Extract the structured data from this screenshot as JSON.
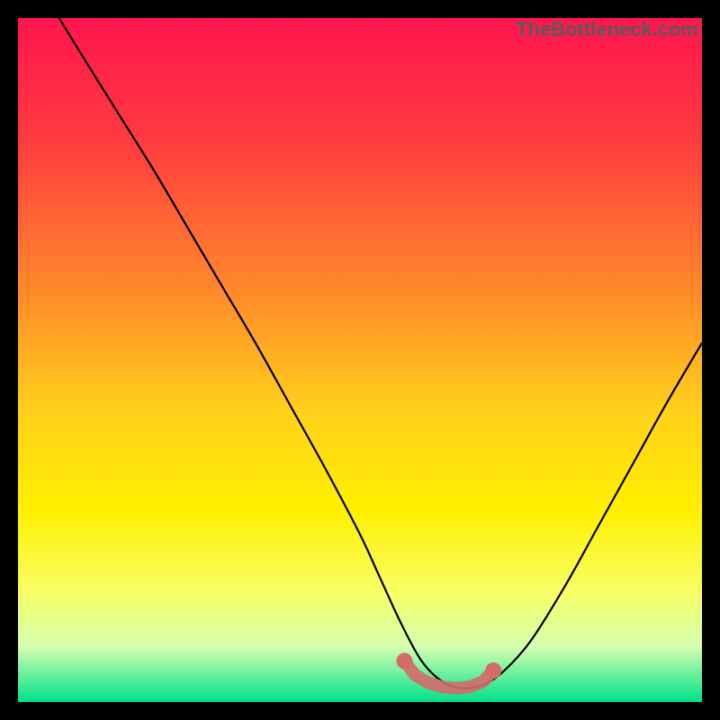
{
  "watermark": "TheBottleneck.com",
  "chart_data": {
    "type": "line",
    "title": "",
    "xlabel": "",
    "ylabel": "",
    "xlim": [
      0,
      100
    ],
    "ylim": [
      0,
      100
    ],
    "gradient_stops": [
      {
        "offset": 0,
        "color": "#ff154f"
      },
      {
        "offset": 18,
        "color": "#ff3b3f"
      },
      {
        "offset": 40,
        "color": "#ff8a2a"
      },
      {
        "offset": 58,
        "color": "#ffd21a"
      },
      {
        "offset": 72,
        "color": "#fff000"
      },
      {
        "offset": 84,
        "color": "#f7ff66"
      },
      {
        "offset": 92,
        "color": "#d4ffb0"
      },
      {
        "offset": 100,
        "color": "#00e08a"
      }
    ],
    "series": [
      {
        "name": "curve",
        "stroke": "#000000",
        "x": [
          6,
          10,
          15,
          20,
          25,
          30,
          35,
          40,
          45,
          50,
          53,
          56,
          59,
          62,
          65,
          68,
          71,
          75,
          80,
          85,
          90,
          95,
          100
        ],
        "values": [
          100,
          93.5,
          85.5,
          77.5,
          69.0,
          60.5,
          52.0,
          43.0,
          34.0,
          24.5,
          18.0,
          11.5,
          6.0,
          3.0,
          2.0,
          2.5,
          4.5,
          9.0,
          17.0,
          26.0,
          35.0,
          44.0,
          52.5
        ]
      }
    ],
    "markers": {
      "name": "flat-region",
      "color": "#d46a6a",
      "x": [
        56.5,
        58,
        60,
        62,
        64,
        66,
        68,
        69.5
      ],
      "values": [
        6.0,
        4.0,
        2.8,
        2.2,
        2.0,
        2.2,
        3.0,
        4.6
      ]
    }
  }
}
